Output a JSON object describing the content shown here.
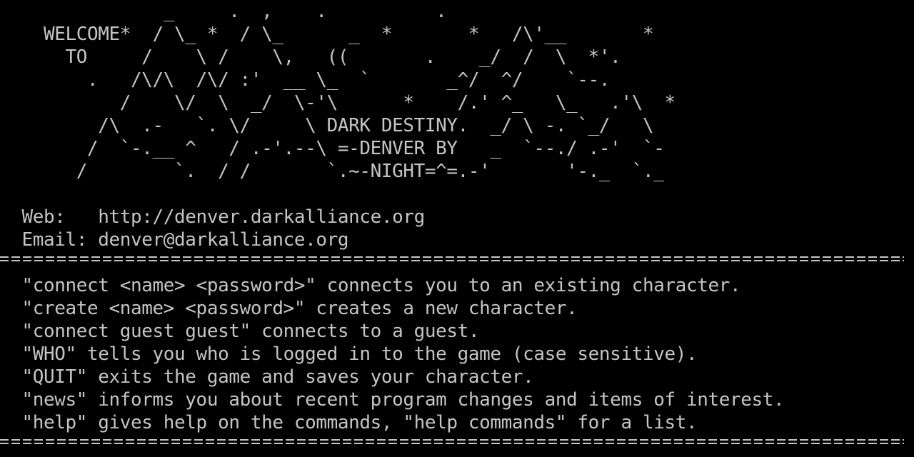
{
  "terminal": {
    "colors": {
      "background": "#000000",
      "foreground": "#c4c4c4"
    },
    "banner": {
      "lines": [
        "               _     .  ,    .          .",
        "    WELCOME*  / \\_ *  / \\_      _  *       *   /\\'__       *",
        "      TO     /    \\ /    \\,   ((       .    _/  /  \\  *'.",
        "        .   /\\/\\  /\\/ :'  __ \\_  `       _^/  ^/    `--.",
        "           /    \\/  \\  _/  \\-'\\      *    /.' ^_   \\_   .'\\  *",
        "         /\\  .-   `. \\/     \\ DARK DESTINY.  _/ \\ -. `_/   \\",
        "        /  `-.__ ^   / .-'.--\\ =-DENVER BY   _  `--./ .-'  `-",
        "       /        `.  / /       `.~-NIGHT=^=.-'       '-._  `._"
      ]
    },
    "web_line": "  Web:   http://denver.darkalliance.org",
    "email_line": "  Email: denver@darkalliance.org",
    "commands": [
      "  \"connect <name> <password>\" connects you to an existing character.",
      "  \"create <name> <password>\" creates a new character.",
      "  \"connect guest guest\" connects to a guest.",
      "  \"WHO\" tells you who is logged in to the game (case sensitive).",
      "  \"QUIT\" exits the game and saves your character.",
      "  \"news\" informs you about recent program changes and items of interest.",
      "  \"help\" gives help on the commands, \"help commands\" for a list."
    ]
  }
}
